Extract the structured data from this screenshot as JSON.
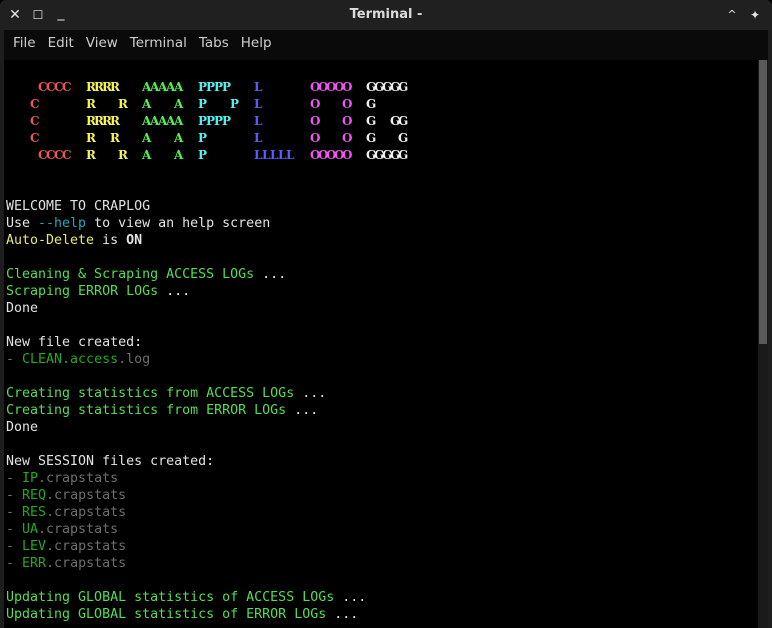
{
  "window": {
    "title": "Terminal -",
    "controls": {
      "close": "✕",
      "maximize": "☐",
      "minimize": "_",
      "shade": "^",
      "stick": "✦"
    }
  },
  "menu": [
    "File",
    "Edit",
    "View",
    "Terminal",
    "Tabs",
    "Help"
  ],
  "colors": {
    "C": "#ee5555",
    "R": "#f5f55a",
    "A": "#55ee55",
    "P": "#55f0f0",
    "L": "#5b5bff",
    "O": "#f055f0",
    "G": "#f0f0f0",
    "white": "#e3e3e3",
    "yellow": "#e8e870",
    "cyan": "#2aa6b8",
    "green": "#55dd55",
    "darkgreen": "#22aa22",
    "gray": "#6e6e6e"
  },
  "logo": [
    "    CCCC  RRRR   AAAAA  PPPP   L      OOOOO  GGGGG",
    "   C      R   R  A   A  P   P  L      O   O  G",
    "   C      RRRR   AAAAA  PPPP   L      O   O  G  GG",
    "   C      R  R   A   A  P      L      O   O  G   G",
    "    CCCC  R   R  A   A  P      LLLLL  OOOOO  GGGGG"
  ],
  "output": [
    [],
    [],
    [
      {
        "t": "WELCOME TO CRAPLOG",
        "c": "white"
      }
    ],
    [
      {
        "t": "Use ",
        "c": "white"
      },
      {
        "t": "--help",
        "c": "cyan"
      },
      {
        "t": " to view an help screen",
        "c": "white"
      }
    ],
    [
      {
        "t": "Auto-Delete",
        "c": "yellow"
      },
      {
        "t": " is ",
        "c": "white"
      },
      {
        "t": "ON",
        "c": "white",
        "b": true
      }
    ],
    [],
    [
      {
        "t": "Cleaning & Scraping ACCESS LOGs",
        "c": "green"
      },
      {
        "t": " ...",
        "c": "white"
      }
    ],
    [
      {
        "t": "Scraping ERROR LOGs",
        "c": "green"
      },
      {
        "t": " ...",
        "c": "white"
      }
    ],
    [
      {
        "t": "Done",
        "c": "white"
      }
    ],
    [],
    [
      {
        "t": "New file created:",
        "c": "white"
      }
    ],
    [
      {
        "t": "- ",
        "c": "gray"
      },
      {
        "t": "CLEAN.access",
        "c": "darkgreen"
      },
      {
        "t": ".log",
        "c": "gray"
      }
    ],
    [],
    [
      {
        "t": "Creating statistics from ACCESS LOGs",
        "c": "green"
      },
      {
        "t": " ...",
        "c": "white"
      }
    ],
    [
      {
        "t": "Creating statistics from ERROR LOGs",
        "c": "green"
      },
      {
        "t": " ...",
        "c": "white"
      }
    ],
    [
      {
        "t": "Done",
        "c": "white"
      }
    ],
    [],
    [
      {
        "t": "New SESSION files created:",
        "c": "white"
      }
    ],
    [
      {
        "t": "- ",
        "c": "gray"
      },
      {
        "t": "IP",
        "c": "darkgreen"
      },
      {
        "t": ".crapstats",
        "c": "gray"
      }
    ],
    [
      {
        "t": "- ",
        "c": "gray"
      },
      {
        "t": "REQ",
        "c": "darkgreen"
      },
      {
        "t": ".crapstats",
        "c": "gray"
      }
    ],
    [
      {
        "t": "- ",
        "c": "gray"
      },
      {
        "t": "RES",
        "c": "darkgreen"
      },
      {
        "t": ".crapstats",
        "c": "gray"
      }
    ],
    [
      {
        "t": "- ",
        "c": "gray"
      },
      {
        "t": "UA",
        "c": "darkgreen"
      },
      {
        "t": ".crapstats",
        "c": "gray"
      }
    ],
    [
      {
        "t": "- ",
        "c": "gray"
      },
      {
        "t": "LEV",
        "c": "darkgreen"
      },
      {
        "t": ".crapstats",
        "c": "gray"
      }
    ],
    [
      {
        "t": "- ",
        "c": "gray"
      },
      {
        "t": "ERR",
        "c": "darkgreen"
      },
      {
        "t": ".crapstats",
        "c": "gray"
      }
    ],
    [],
    [
      {
        "t": "Updating GLOBAL statistics of ACCESS LOGs",
        "c": "green"
      },
      {
        "t": " ...",
        "c": "white"
      }
    ],
    [
      {
        "t": "Updating GLOBAL statistics of ERROR LOGs",
        "c": "green"
      },
      {
        "t": " ...",
        "c": "white"
      }
    ]
  ],
  "scroll": {
    "position_fraction": 0.0,
    "visible_fraction": 0.5
  }
}
